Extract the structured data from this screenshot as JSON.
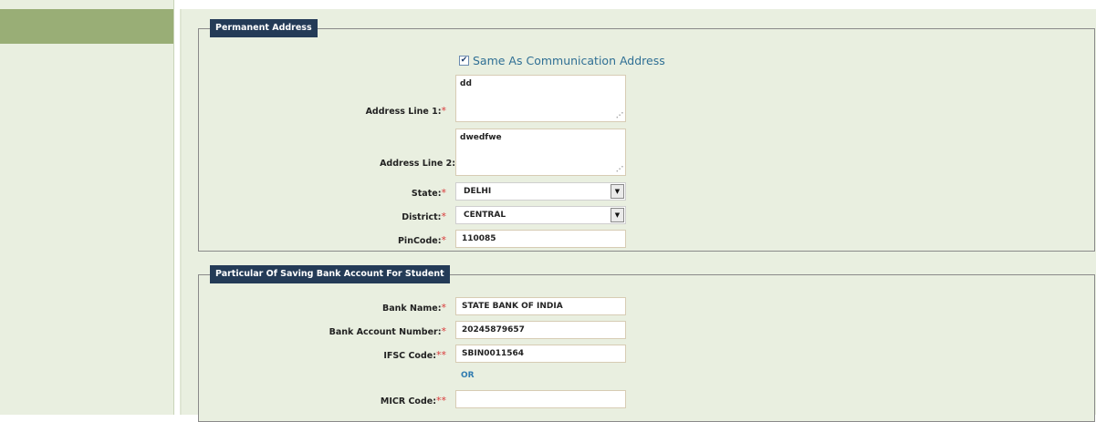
{
  "permanent_address": {
    "legend": "Permanent Address",
    "same_as_label": "Same As Communication Address",
    "same_as_checked": true,
    "address_line1": {
      "label": "Address Line 1:",
      "required": "*",
      "value": "dd"
    },
    "address_line2": {
      "label": "Address Line 2:",
      "value": "dwedfwe"
    },
    "state": {
      "label": "State:",
      "required": "*",
      "value": "DELHI"
    },
    "district": {
      "label": "District:",
      "required": "*",
      "value": "CENTRAL"
    },
    "pincode": {
      "label": "PinCode:",
      "required": "*",
      "value": "110085"
    }
  },
  "bank_account": {
    "legend": "Particular Of Saving Bank Account For Student",
    "bank_name": {
      "label": "Bank Name:",
      "required": "*",
      "value": "STATE BANK OF INDIA"
    },
    "account_number": {
      "label": "Bank Account Number:",
      "required": "*",
      "value": "20245879657"
    },
    "ifsc": {
      "label": "IFSC Code:",
      "required": "**",
      "value": "SBIN0011564"
    },
    "or_text": "OR",
    "micr": {
      "label": "MICR Code:",
      "required": "**",
      "value": ""
    }
  },
  "icons": {
    "checkbox_mark": "☑",
    "dropdown_arrow": "▼",
    "resize_grip": "⠿"
  }
}
